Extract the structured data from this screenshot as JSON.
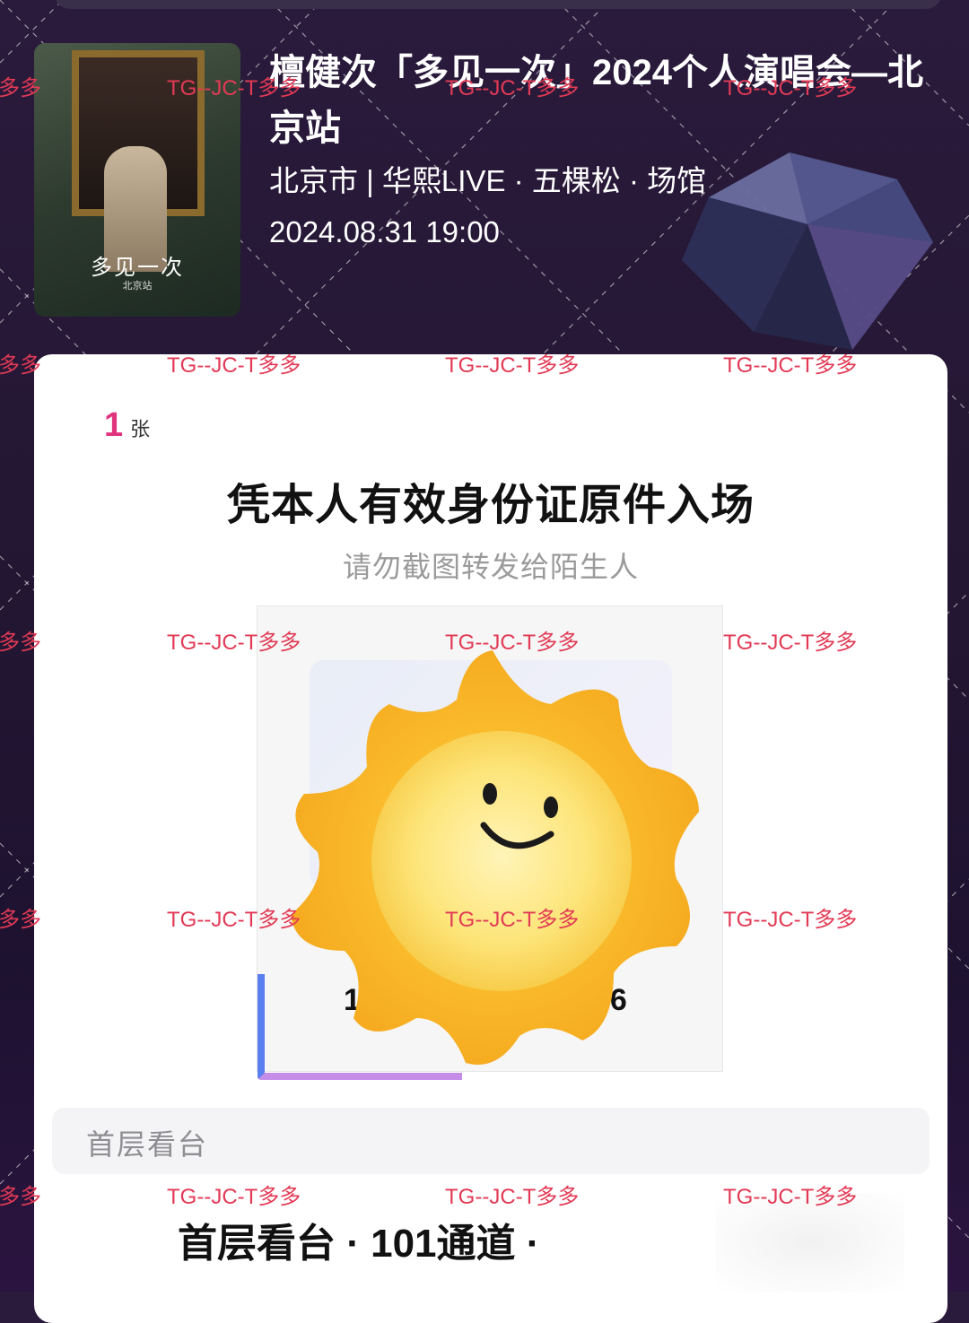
{
  "event": {
    "title": "檀健次「多见一次」2024个人演唱会—北京站",
    "venue": "北京市 | 华熙LIVE · 五棵松 · 场馆",
    "datetime": "2024.08.31 19:00",
    "poster_title": "多见一次",
    "poster_subtitle": "北京站"
  },
  "ticket": {
    "quantity": "1",
    "quantity_unit": "张",
    "entry_rule": "凭本人有效身份证原件入场",
    "warning": "请勿截图转发给陌生人",
    "code_left": "11",
    "code_right": "446",
    "section_label": "首层看台",
    "seat_text": "首层看台 · 101通道 ·"
  },
  "watermark": {
    "text": "TG--JC-T多多",
    "edge_text": "多多",
    "color": "#e23a55"
  },
  "colors": {
    "accent": "#e0337d",
    "background": "#241733"
  }
}
